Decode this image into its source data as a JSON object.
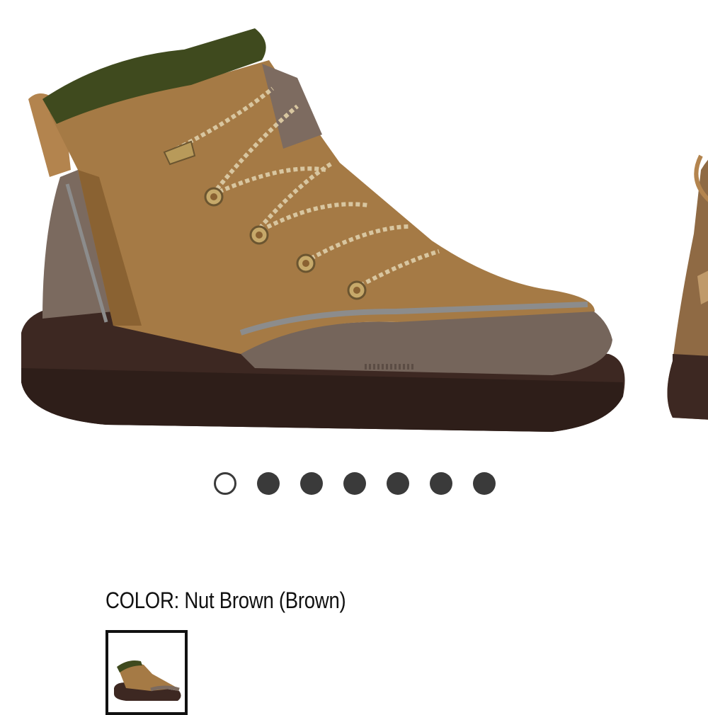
{
  "product": {
    "image_alt": "Nut Brown boot",
    "color_label": "COLOR: Nut Brown (Brown)"
  },
  "carousel": {
    "total_slides": 7,
    "active_index": 0
  },
  "colors": {
    "tan": "#a57a45",
    "tan_dark": "#8a6232",
    "taupe": "#7b6a5f",
    "sole": "#3d2822",
    "collar": "#3f4a1e",
    "dot": "#3a3a3a"
  }
}
